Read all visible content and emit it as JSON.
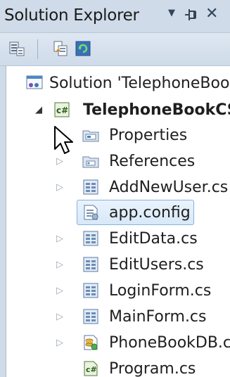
{
  "panel": {
    "title": "Solution Explorer",
    "buttons": {
      "dropdown": "▼",
      "pin": "⊣",
      "close": "✕"
    }
  },
  "toolbar": {
    "items": [
      "properties-icon",
      "show-all-files-icon",
      "refresh-icon"
    ]
  },
  "tree": {
    "solution": "Solution 'TelephoneBookCS'",
    "project": "TelephoneBookCS",
    "items": [
      {
        "label": "Properties",
        "icon": "properties-folder-icon",
        "expandable": true
      },
      {
        "label": "References",
        "icon": "references-folder-icon",
        "expandable": true
      },
      {
        "label": "AddNewUser.cs",
        "icon": "form-file-icon",
        "expandable": true
      },
      {
        "label": "app.config",
        "icon": "config-file-icon",
        "expandable": false,
        "selected": true
      },
      {
        "label": "EditData.cs",
        "icon": "form-file-icon",
        "expandable": true
      },
      {
        "label": "EditUsers.cs",
        "icon": "form-file-icon",
        "expandable": true
      },
      {
        "label": "LoginForm.cs",
        "icon": "form-file-icon",
        "expandable": true
      },
      {
        "label": "MainForm.cs",
        "icon": "form-file-icon",
        "expandable": true
      },
      {
        "label": "PhoneBookDB.cs",
        "icon": "database-file-icon",
        "expandable": true
      },
      {
        "label": "Program.cs",
        "icon": "csharp-file-icon",
        "expandable": false
      }
    ]
  },
  "colors": {
    "titlebar": "#cfdbe8",
    "selection_border": "#86b2dd",
    "selection_fill": "#d7e8f8"
  }
}
